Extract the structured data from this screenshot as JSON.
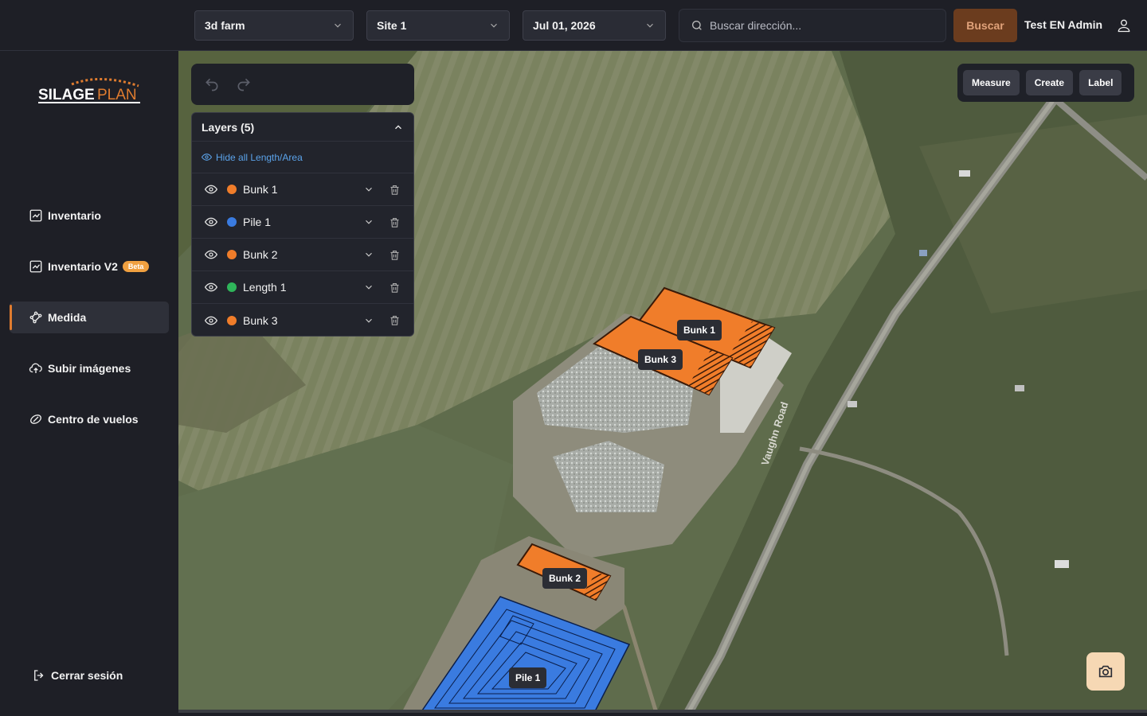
{
  "header": {
    "farm_select": "3d farm",
    "site_select": "Site 1",
    "date_select": "Jul 01, 2026",
    "search_placeholder": "Buscar dirección...",
    "search_button": "Buscar",
    "user_name": "Test EN Admin"
  },
  "sidebar": {
    "logo_text_a": "SILAGE",
    "logo_text_b": "PLAN",
    "items": [
      {
        "label": "Inventario",
        "icon": "chart-icon"
      },
      {
        "label": "Inventario V2",
        "icon": "chart-icon",
        "badge": "Beta"
      },
      {
        "label": "Medida",
        "icon": "measure-icon",
        "active": true
      },
      {
        "label": "Subir imágenes",
        "icon": "upload-cloud-icon"
      },
      {
        "label": "Centro de vuelos",
        "icon": "drone-icon"
      }
    ],
    "logout": "Cerrar sesión"
  },
  "layers": {
    "title": "Layers (5)",
    "hide_all": "Hide all Length/Area",
    "items": [
      {
        "name": "Bunk 1",
        "color": "#f07d2a"
      },
      {
        "name": "Pile 1",
        "color": "#3a7be0"
      },
      {
        "name": "Bunk 2",
        "color": "#f07d2a"
      },
      {
        "name": "Length 1",
        "color": "#2fb55a"
      },
      {
        "name": "Bunk 3",
        "color": "#f07d2a"
      }
    ]
  },
  "tools": {
    "measure": "Measure",
    "create": "Create",
    "label": "Label"
  },
  "map": {
    "road_label": "Vaughn Road",
    "labels": {
      "bunk1": "Bunk 1",
      "bunk3": "Bunk 3",
      "bunk2": "Bunk 2",
      "pile1": "Pile 1"
    }
  },
  "colors": {
    "accent": "#e07c2f",
    "bunk": "#f07d2a",
    "pile": "#3a7be0"
  }
}
